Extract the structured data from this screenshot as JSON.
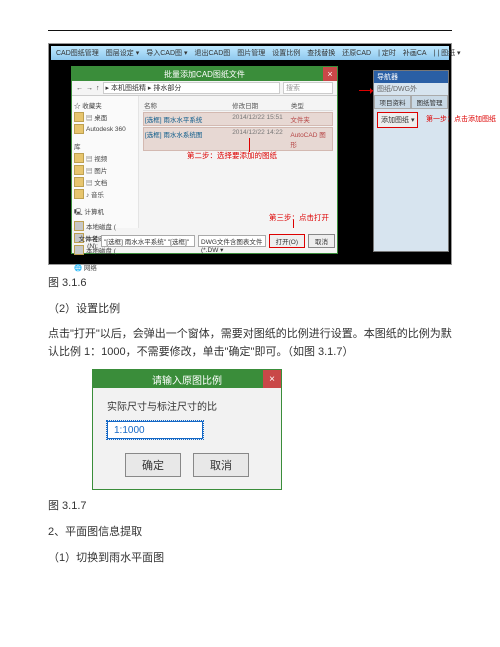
{
  "toolbar": {
    "items": [
      "CAD图纸管理",
      "图层设定 ▾",
      "导入CAD图 ▾",
      "退出CAD图",
      "图片管理",
      "设置比例",
      "查找替换",
      "还原CAD",
      "| 定时",
      "补画CA",
      "| | 图纸 ▾"
    ]
  },
  "panel": {
    "tab": "导航器",
    "hint": "图纸/DWG外",
    "tabs": [
      "项目资料",
      "图纸管理"
    ],
    "add_label": "添加图纸 ▾"
  },
  "notes": {
    "n1": "第一步：点击添加图纸",
    "n2": "第二步：选择要添加的图纸",
    "n3": "第三步：点击打开"
  },
  "dlg": {
    "title": "批量添加CAD图纸文件",
    "nav": {
      "back": "←",
      "fwd": "→",
      "up": "↑",
      "path": "▸ 本机图纸精 ▸ 排水部分",
      "search": "搜索"
    },
    "sidebar": [
      "☆ 收藏夹",
      "▤ 桌面",
      "Autodesk 360",
      "",
      "库",
      "▤ 视频",
      "▤ 图片",
      "▤ 文档",
      "♪ 音乐",
      "",
      "🖳 计算机",
      "本地磁盘 (",
      "本地磁盘 (",
      "本地磁盘 (",
      "",
      "🌐 网络"
    ],
    "header": [
      "名称",
      "修改日期",
      "类型"
    ],
    "rows": [
      [
        "[选框] 雨水水平系统",
        "2014/12/22 15:51",
        "文件夹"
      ],
      [
        "[选框] 雨水水系统图",
        "2014/12/22 14:22",
        "AutoCAD 图形"
      ]
    ],
    "file_lbl": "文件名(N):",
    "open": "打开(O)",
    "cancel": "取消",
    "file_value": "\"[选框] 雨水水平系统\" \"[选框]\"",
    "filter": "DWG文件含图表文件(*.DW ▾"
  },
  "body": {
    "fig1_cap": "图 3.1.6",
    "sec2": "（2）设置比例",
    "para": "点击\"打开\"以后，会弹出一个窗体，需要对图纸的比例进行设置。本图纸的比例为默认比例 1：1000，不需要修改，单击\"确定\"即可。（如图 3.1.7）",
    "fig2_cap": "图 3.1.7",
    "sec_plan": "2、平面图信息提取",
    "sec_switch": "（1）切换到雨水平面图"
  },
  "fig2": {
    "title": "请输入原图比例",
    "label": "实际尺寸与标注尺寸的比",
    "value": "1:1000",
    "ok": "确定",
    "cancel": "取消"
  }
}
